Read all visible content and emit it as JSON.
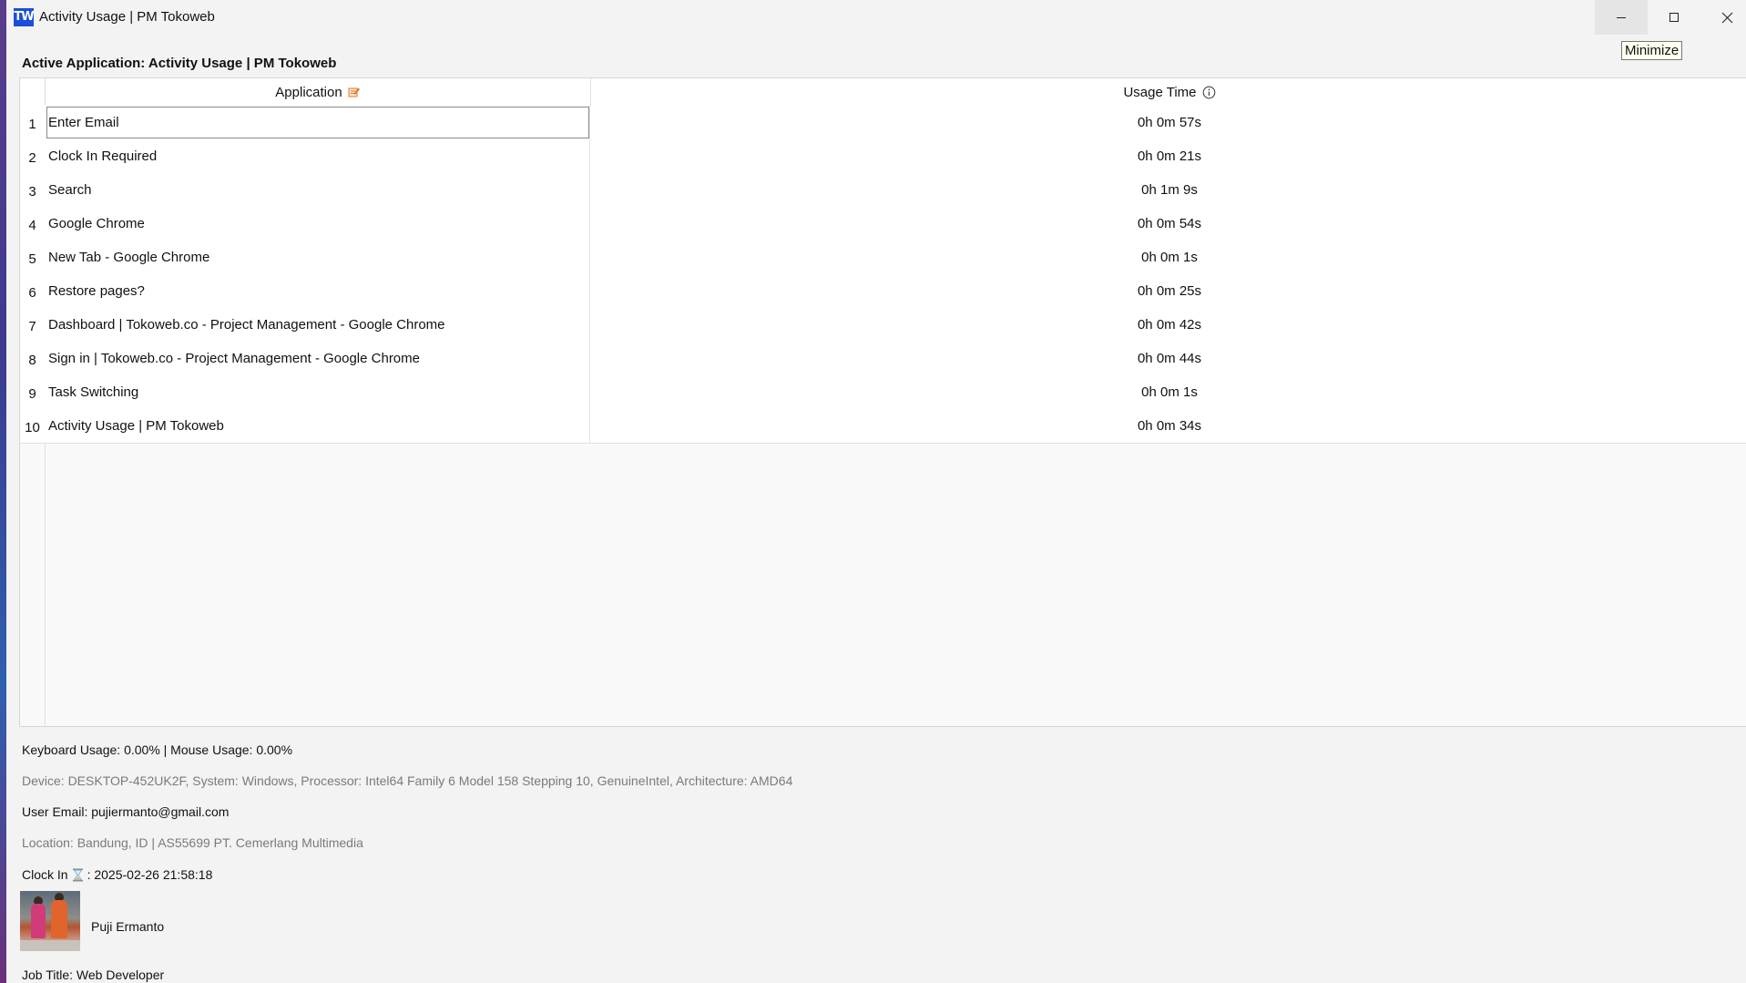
{
  "window": {
    "icon_text": "TW",
    "title": "Activity Usage | PM Tokoweb",
    "tooltip": "Minimize"
  },
  "active_application": "Active Application: Activity Usage | PM Tokoweb",
  "table": {
    "columns": [
      "Application",
      "Usage Time"
    ],
    "rows": [
      {
        "num": "1",
        "application": "Enter Email",
        "usage_time": "0h 0m 57s"
      },
      {
        "num": "2",
        "application": "Clock In Required",
        "usage_time": "0h 0m 21s"
      },
      {
        "num": "3",
        "application": "Search",
        "usage_time": "0h 1m 9s"
      },
      {
        "num": "4",
        "application": "Google Chrome",
        "usage_time": "0h 0m 54s"
      },
      {
        "num": "5",
        "application": "New Tab - Google Chrome",
        "usage_time": "0h 0m 1s"
      },
      {
        "num": "6",
        "application": "Restore pages?",
        "usage_time": "0h 0m 25s"
      },
      {
        "num": "7",
        "application": "Dashboard | Tokoweb.co - Project Management - Google Chrome",
        "usage_time": "0h 0m 42s"
      },
      {
        "num": "8",
        "application": "Sign in | Tokoweb.co - Project Management - Google Chrome",
        "usage_time": "0h 0m 44s"
      },
      {
        "num": "9",
        "application": "Task Switching",
        "usage_time": "0h 0m 1s"
      },
      {
        "num": "10",
        "application": "Activity Usage | PM Tokoweb",
        "usage_time": "0h 0m 34s"
      }
    ]
  },
  "footer": {
    "input_usage": "Keyboard Usage: 0.00% | Mouse Usage: 0.00%",
    "device": "Device: DESKTOP-452UK2F, System: Windows, Processor: Intel64 Family 6 Model 158 Stepping 10, GenuineIntel, Architecture: AMD64",
    "user_email": "User Email: pujiermanto@gmail.com",
    "location": "Location: Bandung, ID | AS55699 PT. Cemerlang Multimedia",
    "clock_in_label": "Clock In",
    "clock_in_icon": "hourglass-icon",
    "clock_in_value": ": 2025-02-26 21:58:18",
    "user_name": "Puji Ermanto",
    "job_title": "Job Title: Web Developer"
  },
  "icons": {
    "application_header": "edit-icon",
    "usage_header": "info-icon"
  },
  "colors": {
    "app_icon_bg": "#1a4fd8",
    "header_edit_icon": "#e07a2c"
  }
}
